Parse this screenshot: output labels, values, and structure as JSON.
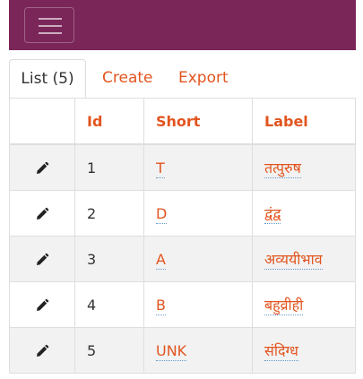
{
  "colors": {
    "navbar": "#7a2658",
    "accent": "#e2551f",
    "stripe": "#f2f2f2"
  },
  "navbar": {
    "toggle_icon": "hamburger-icon"
  },
  "tabs": [
    {
      "label": "List (5)",
      "active": true
    },
    {
      "label": "Create",
      "active": false
    },
    {
      "label": "Export",
      "active": false
    }
  ],
  "table": {
    "headers": [
      "",
      "Id",
      "Short",
      "Label"
    ],
    "rows": [
      {
        "id": "1",
        "short": "T",
        "label": "तत्पुरुष"
      },
      {
        "id": "2",
        "short": "D",
        "label": "द्वंद्व"
      },
      {
        "id": "3",
        "short": "A",
        "label": "अव्ययीभाव"
      },
      {
        "id": "4",
        "short": "B",
        "label": "बहुव्रीही"
      },
      {
        "id": "5",
        "short": "UNK",
        "label": "संदिग्ध"
      }
    ],
    "edit_icon": "pencil-icon"
  }
}
